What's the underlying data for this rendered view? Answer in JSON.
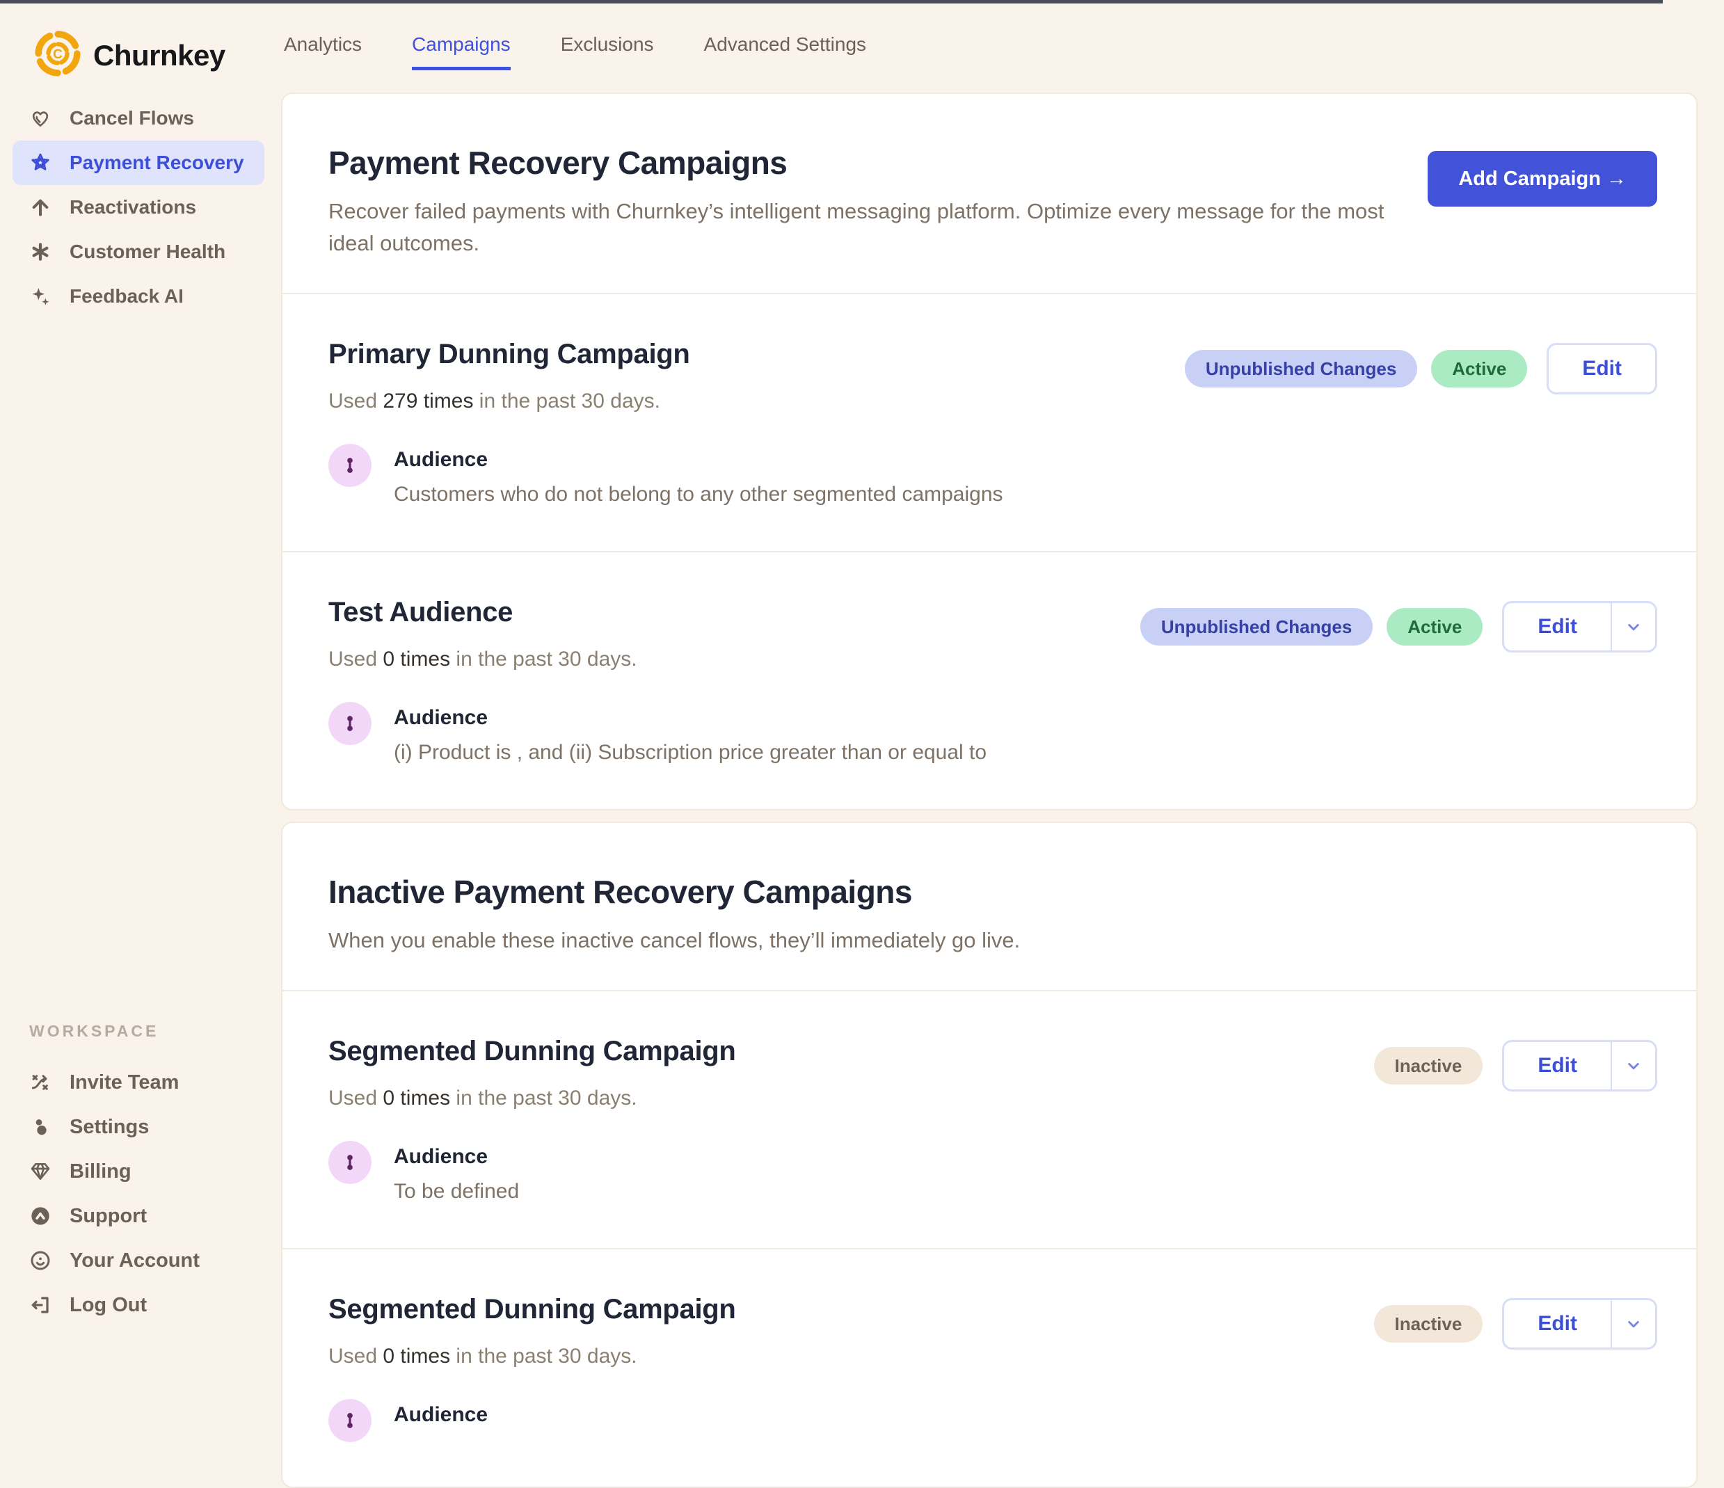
{
  "brand": {
    "name": "Churnkey"
  },
  "topnav": {
    "tabs": [
      {
        "label": "Analytics",
        "active": false
      },
      {
        "label": "Campaigns",
        "active": true
      },
      {
        "label": "Exclusions",
        "active": false
      },
      {
        "label": "Advanced Settings",
        "active": false
      }
    ]
  },
  "sidebar": {
    "items": [
      {
        "label": "Cancel Flows",
        "icon": "heart-icon",
        "selected": false
      },
      {
        "label": "Payment Recovery",
        "icon": "star-icon",
        "selected": true
      },
      {
        "label": "Reactivations",
        "icon": "arrow-up-icon",
        "selected": false
      },
      {
        "label": "Customer Health",
        "icon": "asterisk-icon",
        "selected": false
      },
      {
        "label": "Feedback AI",
        "icon": "sparkles-icon",
        "selected": false
      }
    ],
    "workspace_label": "WORKSPACE",
    "workspace_items": [
      {
        "label": "Invite Team",
        "icon": "shuffle-icon"
      },
      {
        "label": "Settings",
        "icon": "dots-icon"
      },
      {
        "label": "Billing",
        "icon": "gem-icon"
      },
      {
        "label": "Support",
        "icon": "support-icon"
      },
      {
        "label": "Your Account",
        "icon": "account-icon"
      },
      {
        "label": "Log Out",
        "icon": "logout-icon"
      }
    ]
  },
  "active_section": {
    "title": "Payment Recovery Campaigns",
    "description": "Recover failed payments with Churnkey’s intelligent messaging platform. Optimize every message for the most ideal outcomes.",
    "add_button_label": "Add Campaign →",
    "campaigns": [
      {
        "name": "Primary Dunning Campaign",
        "usage_prefix": "Used",
        "usage_count": "279 times",
        "usage_suffix": "in the past 30 days.",
        "audience_label": "Audience",
        "audience_description": "Customers who do not belong to any other segmented campaigns",
        "badges": [
          "Unpublished Changes",
          "Active"
        ],
        "edit_label": "Edit",
        "has_dropdown": false
      },
      {
        "name": "Test Audience",
        "usage_prefix": "Used",
        "usage_count": "0 times",
        "usage_suffix": "in the past 30 days.",
        "audience_label": "Audience",
        "audience_description": "(i) Product is , and (ii) Subscription price greater than or equal to",
        "badges": [
          "Unpublished Changes",
          "Active"
        ],
        "edit_label": "Edit",
        "has_dropdown": true
      }
    ]
  },
  "inactive_section": {
    "title": "Inactive Payment Recovery Campaigns",
    "description": "When you enable these inactive cancel flows, they’ll immediately go live.",
    "campaigns": [
      {
        "name": "Segmented Dunning Campaign",
        "usage_prefix": "Used",
        "usage_count": "0 times",
        "usage_suffix": "in the past 30 days.",
        "audience_label": "Audience",
        "audience_description": "To be defined",
        "badges": [
          "Inactive"
        ],
        "edit_label": "Edit",
        "has_dropdown": true
      },
      {
        "name": "Segmented Dunning Campaign",
        "usage_prefix": "Used",
        "usage_count": "0 times",
        "usage_suffix": "in the past 30 days.",
        "audience_label": "Audience",
        "audience_description": "",
        "badges": [
          "Inactive"
        ],
        "edit_label": "Edit",
        "has_dropdown": true
      }
    ]
  },
  "colors": {
    "page_background": "#FAF3EB",
    "accent_blue": "#4353D9",
    "badge_unpublished_bg": "#C9D0F5",
    "badge_unpublished_text": "#3740A6",
    "badge_active_bg": "#ABEBC3",
    "badge_active_text": "#1E6B40",
    "badge_inactive_bg": "#F3E7DA",
    "badge_inactive_text": "#6B6156",
    "sidebar_selected_bg": "#DFE3FB",
    "logo_gold": "#F2A60D",
    "audience_icon_bg": "#F3D7F8",
    "audience_icon_glyph": "#5E2663"
  }
}
